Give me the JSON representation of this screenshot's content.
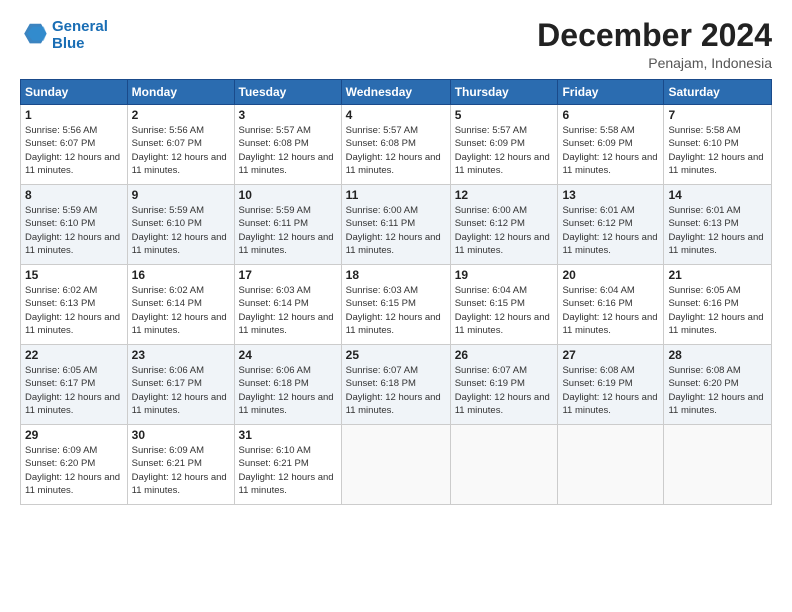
{
  "logo": {
    "line1": "General",
    "line2": "Blue"
  },
  "header": {
    "month": "December 2024",
    "location": "Penajam, Indonesia"
  },
  "weekdays": [
    "Sunday",
    "Monday",
    "Tuesday",
    "Wednesday",
    "Thursday",
    "Friday",
    "Saturday"
  ],
  "weeks": [
    [
      {
        "day": "1",
        "sunrise": "5:56 AM",
        "sunset": "6:07 PM",
        "daylight": "12 hours and 11 minutes."
      },
      {
        "day": "2",
        "sunrise": "5:56 AM",
        "sunset": "6:07 PM",
        "daylight": "12 hours and 11 minutes."
      },
      {
        "day": "3",
        "sunrise": "5:57 AM",
        "sunset": "6:08 PM",
        "daylight": "12 hours and 11 minutes."
      },
      {
        "day": "4",
        "sunrise": "5:57 AM",
        "sunset": "6:08 PM",
        "daylight": "12 hours and 11 minutes."
      },
      {
        "day": "5",
        "sunrise": "5:57 AM",
        "sunset": "6:09 PM",
        "daylight": "12 hours and 11 minutes."
      },
      {
        "day": "6",
        "sunrise": "5:58 AM",
        "sunset": "6:09 PM",
        "daylight": "12 hours and 11 minutes."
      },
      {
        "day": "7",
        "sunrise": "5:58 AM",
        "sunset": "6:10 PM",
        "daylight": "12 hours and 11 minutes."
      }
    ],
    [
      {
        "day": "8",
        "sunrise": "5:59 AM",
        "sunset": "6:10 PM",
        "daylight": "12 hours and 11 minutes."
      },
      {
        "day": "9",
        "sunrise": "5:59 AM",
        "sunset": "6:10 PM",
        "daylight": "12 hours and 11 minutes."
      },
      {
        "day": "10",
        "sunrise": "5:59 AM",
        "sunset": "6:11 PM",
        "daylight": "12 hours and 11 minutes."
      },
      {
        "day": "11",
        "sunrise": "6:00 AM",
        "sunset": "6:11 PM",
        "daylight": "12 hours and 11 minutes."
      },
      {
        "day": "12",
        "sunrise": "6:00 AM",
        "sunset": "6:12 PM",
        "daylight": "12 hours and 11 minutes."
      },
      {
        "day": "13",
        "sunrise": "6:01 AM",
        "sunset": "6:12 PM",
        "daylight": "12 hours and 11 minutes."
      },
      {
        "day": "14",
        "sunrise": "6:01 AM",
        "sunset": "6:13 PM",
        "daylight": "12 hours and 11 minutes."
      }
    ],
    [
      {
        "day": "15",
        "sunrise": "6:02 AM",
        "sunset": "6:13 PM",
        "daylight": "12 hours and 11 minutes."
      },
      {
        "day": "16",
        "sunrise": "6:02 AM",
        "sunset": "6:14 PM",
        "daylight": "12 hours and 11 minutes."
      },
      {
        "day": "17",
        "sunrise": "6:03 AM",
        "sunset": "6:14 PM",
        "daylight": "12 hours and 11 minutes."
      },
      {
        "day": "18",
        "sunrise": "6:03 AM",
        "sunset": "6:15 PM",
        "daylight": "12 hours and 11 minutes."
      },
      {
        "day": "19",
        "sunrise": "6:04 AM",
        "sunset": "6:15 PM",
        "daylight": "12 hours and 11 minutes."
      },
      {
        "day": "20",
        "sunrise": "6:04 AM",
        "sunset": "6:16 PM",
        "daylight": "12 hours and 11 minutes."
      },
      {
        "day": "21",
        "sunrise": "6:05 AM",
        "sunset": "6:16 PM",
        "daylight": "12 hours and 11 minutes."
      }
    ],
    [
      {
        "day": "22",
        "sunrise": "6:05 AM",
        "sunset": "6:17 PM",
        "daylight": "12 hours and 11 minutes."
      },
      {
        "day": "23",
        "sunrise": "6:06 AM",
        "sunset": "6:17 PM",
        "daylight": "12 hours and 11 minutes."
      },
      {
        "day": "24",
        "sunrise": "6:06 AM",
        "sunset": "6:18 PM",
        "daylight": "12 hours and 11 minutes."
      },
      {
        "day": "25",
        "sunrise": "6:07 AM",
        "sunset": "6:18 PM",
        "daylight": "12 hours and 11 minutes."
      },
      {
        "day": "26",
        "sunrise": "6:07 AM",
        "sunset": "6:19 PM",
        "daylight": "12 hours and 11 minutes."
      },
      {
        "day": "27",
        "sunrise": "6:08 AM",
        "sunset": "6:19 PM",
        "daylight": "12 hours and 11 minutes."
      },
      {
        "day": "28",
        "sunrise": "6:08 AM",
        "sunset": "6:20 PM",
        "daylight": "12 hours and 11 minutes."
      }
    ],
    [
      {
        "day": "29",
        "sunrise": "6:09 AM",
        "sunset": "6:20 PM",
        "daylight": "12 hours and 11 minutes."
      },
      {
        "day": "30",
        "sunrise": "6:09 AM",
        "sunset": "6:21 PM",
        "daylight": "12 hours and 11 minutes."
      },
      {
        "day": "31",
        "sunrise": "6:10 AM",
        "sunset": "6:21 PM",
        "daylight": "12 hours and 11 minutes."
      },
      null,
      null,
      null,
      null
    ]
  ],
  "labels": {
    "sunrise": "Sunrise:",
    "sunset": "Sunset:",
    "daylight": "Daylight:"
  }
}
